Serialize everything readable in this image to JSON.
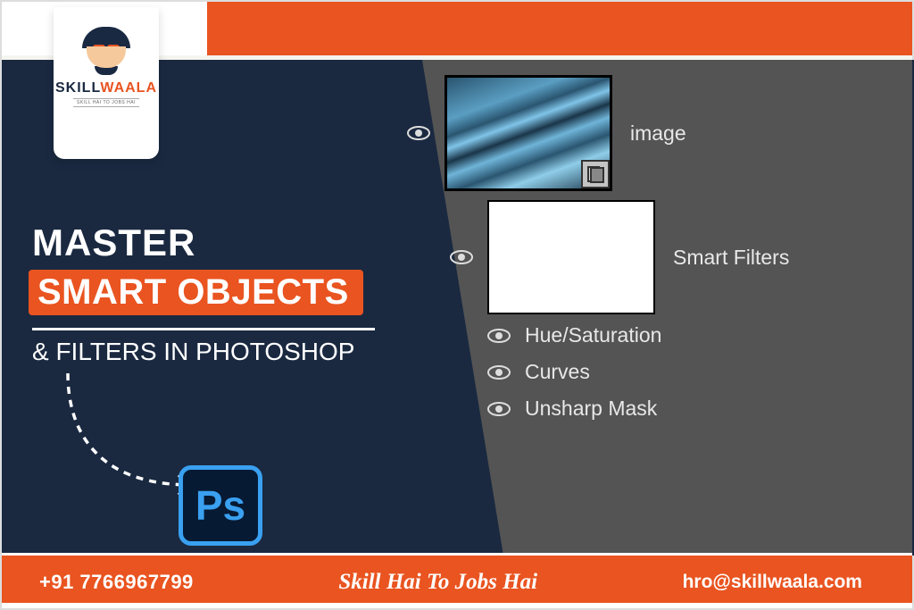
{
  "brand": {
    "name_part1": "SKILL",
    "name_part2": "WAALA",
    "tagline_small": "SKILL HAI TO JOBS HAI"
  },
  "headline": {
    "line1": "MASTER",
    "line2": "SMART OBJECTS",
    "line3": "& FILTERS IN PHOTOSHOP"
  },
  "icons": {
    "ps": "Ps",
    "eye": "eye-icon",
    "smart_object_badge": "smart-object-badge"
  },
  "layers": {
    "thumb_label": "image",
    "filters_label": "Smart Filters",
    "items": [
      {
        "label": "Hue/Saturation"
      },
      {
        "label": "Curves"
      },
      {
        "label": "Unsharp Mask"
      }
    ]
  },
  "footer": {
    "phone": "+91 7766967799",
    "tagline": "Skill Hai To Jobs Hai",
    "email": "hro@skillwaala.com"
  },
  "colors": {
    "orange": "#e95420",
    "navy": "#1a2940",
    "grey": "#545454",
    "ps_blue": "#3aa0f0"
  }
}
